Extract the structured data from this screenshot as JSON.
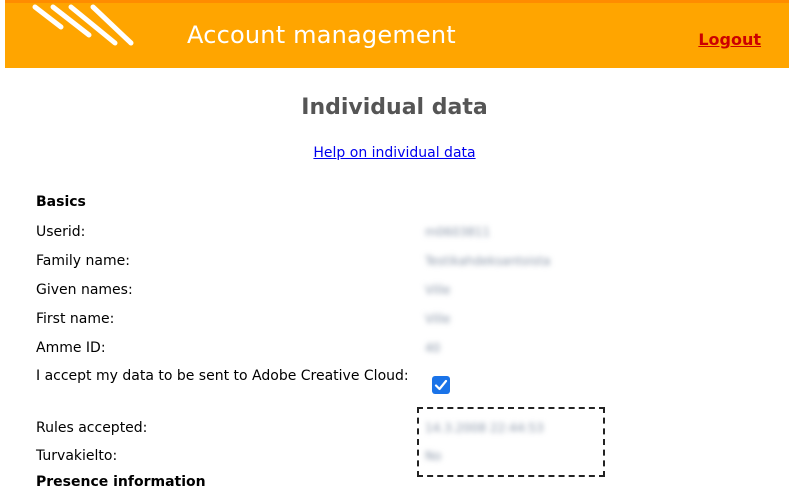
{
  "header": {
    "title": "Account management",
    "logout_label": "Logout",
    "background_color": "#ffa500",
    "logo_icon": "stripes-logo-icon"
  },
  "page": {
    "title": "Individual data",
    "help_link": "Help on individual data"
  },
  "basics": {
    "heading": "Basics",
    "rows": [
      {
        "label": "Userid:",
        "value": "m0603811"
      },
      {
        "label": "Family name:",
        "value": "Testikahdeksantoista"
      },
      {
        "label": "Given names:",
        "value": "Ville"
      },
      {
        "label": "First name:",
        "value": "Ville"
      },
      {
        "label": "Amme ID:",
        "value": "40"
      },
      {
        "label": "I accept my data to be sent to Adobe Creative Cloud:",
        "checked": true
      },
      {
        "label": "Rules accepted:",
        "value": "14.3.2008 22:44:53"
      },
      {
        "label": "Turvakielto:",
        "value": "No"
      }
    ]
  },
  "presence": {
    "heading": "Presence information"
  }
}
